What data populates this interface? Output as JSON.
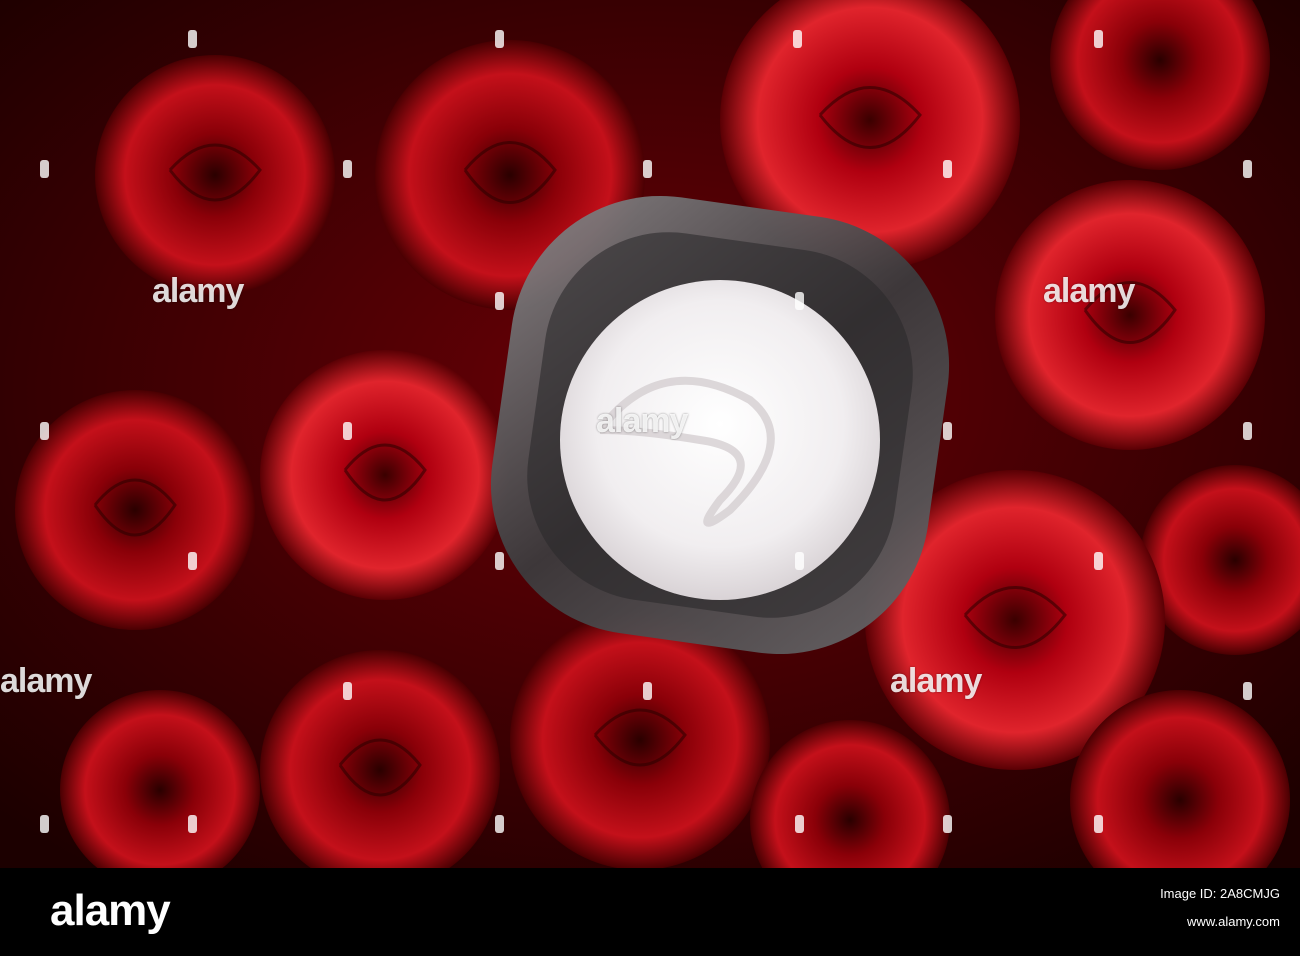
{
  "photo": {
    "subject": "cream-jar-on-red-roses",
    "colors": {
      "rose_dark": "#5a0000",
      "rose_mid": "#b0000e",
      "rose_light": "#e0202a",
      "cream": "#f4f2f3",
      "glass": "#5c5a5c"
    }
  },
  "watermark": {
    "text": "alamy"
  },
  "footer": {
    "logo": "alamy",
    "image_id_line": "Image ID: 2A8CMJG",
    "site": "www.alamy.com"
  }
}
